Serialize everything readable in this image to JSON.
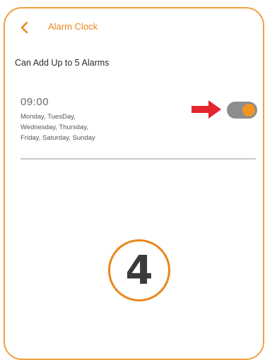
{
  "header": {
    "title": "Alarm Clock",
    "back_icon": "chevron-left-icon"
  },
  "hint": "Can Add Up to 5 Alarms",
  "alarms": [
    {
      "time": "09:00",
      "days_line1": "Monday, TuesDay,",
      "days_line2": "Wednesday, Thursday,",
      "days_line3": "Friday, Saturday, Sunday",
      "enabled": true
    }
  ],
  "annotation": {
    "pointer_icon": "right-arrow-icon",
    "step_number": "4"
  },
  "colors": {
    "accent": "#e9861a",
    "toggle_track": "#8d8d8d",
    "toggle_knob": "#f39424",
    "arrow": "#e3262d",
    "frame_border": "#f0a040"
  }
}
